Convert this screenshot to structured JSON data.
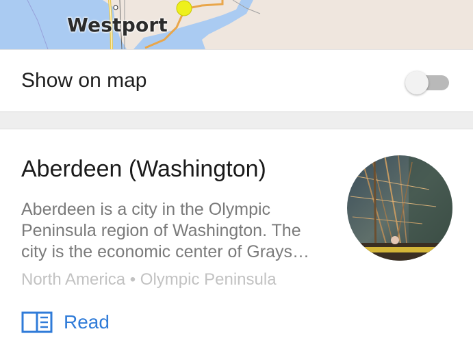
{
  "map": {
    "place_label": "Westport"
  },
  "toggle_row": {
    "label": "Show on map",
    "enabled": false
  },
  "article": {
    "title": "Aberdeen (Washington)",
    "description_lines": [
      "Aberdeen is a city in the Olympic",
      "Peninsula region of Washington. The",
      "city is the economic center of Grays…"
    ],
    "meta": "North America • Olympic Peninsula",
    "read_label": "Read"
  },
  "colors": {
    "accent_blue": "#2f7bd8",
    "map_water": "#aacbf2",
    "map_land": "#efe6de",
    "marker_yellow": "#eef01c"
  },
  "icons": {
    "read": "book-open-icon",
    "marker": "map-marker-dot-icon"
  }
}
